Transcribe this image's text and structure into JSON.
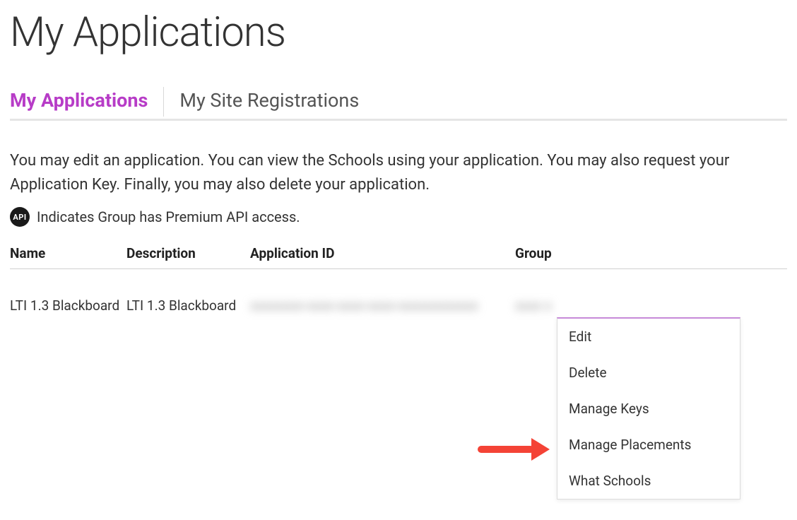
{
  "page": {
    "title": "My Applications"
  },
  "tabs": [
    {
      "label": "My Applications",
      "active": true
    },
    {
      "label": "My Site Registrations",
      "active": false
    }
  ],
  "intro": "You may edit an application. You can view the Schools using your application. You may also request your Application Key. Finally, you may also delete your application.",
  "api_note": {
    "icon": "API",
    "text": "Indicates Group has Premium API access."
  },
  "table": {
    "headers": {
      "name": "Name",
      "description": "Description",
      "application_id": "Application ID",
      "group": "Group"
    },
    "rows": [
      {
        "name": "LTI 1.3 Blackboard",
        "description": "LTI 1.3 Blackboard",
        "application_id": "xxxxxxxx-xxxx-xxxx-xxxx-xxxxxxxxxxxx",
        "group": "xxxx x"
      }
    ]
  },
  "menu": {
    "items": [
      "Edit",
      "Delete",
      "Manage Keys",
      "Manage Placements",
      "What Schools"
    ]
  }
}
